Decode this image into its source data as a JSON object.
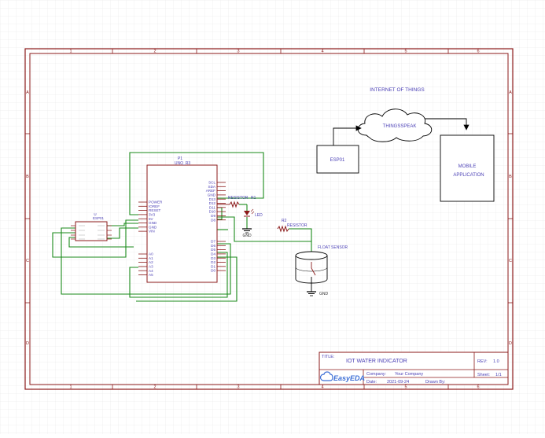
{
  "colors": {
    "frame": "#8b1a1a",
    "wire": "#1a8a1a",
    "text": "#4a3fb5",
    "component": "#8b1a1a",
    "grid": "#e6e6e6"
  },
  "border": {
    "columns": [
      "1",
      "2",
      "3",
      "4",
      "5",
      "6"
    ],
    "rows": [
      "A",
      "B",
      "C",
      "D"
    ]
  },
  "iot": {
    "title": "INTERNET OF THINGS",
    "cloud_label": "THINGSSPEAK",
    "esp_label": "ESP01",
    "mobile_line1": "MOBILE",
    "mobile_line2": "APPLICATION"
  },
  "uno": {
    "ref": "P1",
    "value": "UNO_R3",
    "left_pins": [
      "POWER",
      "IOREF",
      "RESET",
      "3V3",
      "5V",
      "GND",
      "GND",
      "VIN",
      "A0",
      "A1",
      "A2",
      "A3",
      "A4",
      "A5"
    ],
    "right_pins_top": [
      "SCL",
      "SDA",
      "AREF",
      "GND",
      "D13",
      "D12",
      "D11",
      "D10",
      "D9",
      "D8"
    ],
    "right_pins_bottom": [
      "D7",
      "D6",
      "D5",
      "D4",
      "D3",
      "D2",
      "D1",
      "D0"
    ]
  },
  "esp_module": {
    "ref": "U",
    "value": "ESP01"
  },
  "resistor1": {
    "label": "RESISTOR",
    "ref": "R1"
  },
  "resistor2": {
    "label": "RESISTOR",
    "ref": "R2"
  },
  "led": {
    "label": "LED"
  },
  "gnd1": {
    "label": "GND"
  },
  "gnd2": {
    "label": "GND"
  },
  "float_sensor": {
    "label": "FLOAT SENSOR"
  },
  "title_block": {
    "title_key": "TITLE:",
    "title_value": "IOT WATER INDICATOR",
    "rev_key": "REV:",
    "rev_value": "1.0",
    "company_key": "Company:",
    "company_value": "Your Company",
    "sheet_key": "Sheet:",
    "sheet_value": "1/1",
    "date_key": "Date:",
    "date_value": "2021-09-24",
    "drawn_key": "Drawn By:",
    "drawn_value": "",
    "logo": "EasyEDA"
  }
}
